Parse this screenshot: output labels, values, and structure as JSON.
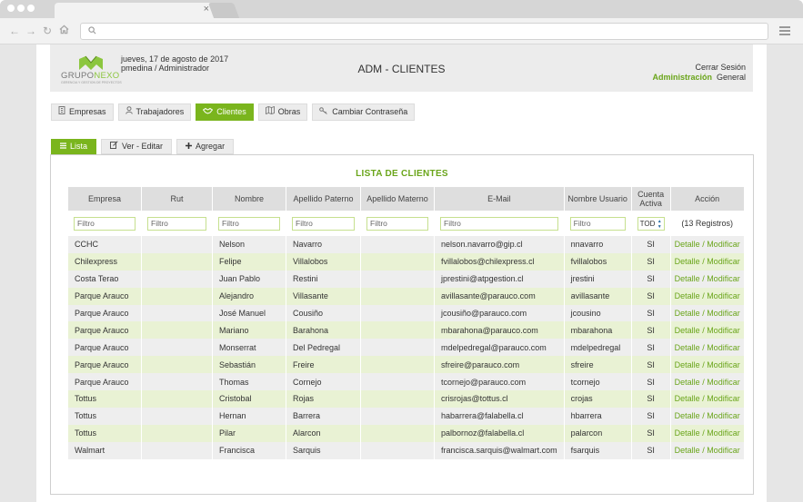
{
  "browser": {
    "tab_close": "×",
    "nav_icons": [
      "back-icon",
      "forward-icon",
      "reload-icon",
      "home-icon"
    ],
    "url_icon": "search-icon"
  },
  "header": {
    "logo_word_1": "GRUPO",
    "logo_word_2": "NEXO",
    "logo_tagline": "GERENCIA Y GESTION DE PROYECTOS",
    "date": "jueves, 17 de agosto de 2017",
    "user": "pmedina / Administrador",
    "title": "ADM - CLIENTES",
    "logout": "Cerrar Sesión",
    "admin_link": "Administración",
    "general_link": "General"
  },
  "mainnav": [
    {
      "label": "Empresas",
      "icon": "building-icon"
    },
    {
      "label": "Trabajadores",
      "icon": "user-icon"
    },
    {
      "label": "Clientes",
      "icon": "handshake-icon"
    },
    {
      "label": "Obras",
      "icon": "map-icon"
    },
    {
      "label": "Cambiar Contraseña",
      "icon": "key-icon"
    }
  ],
  "subnav": [
    {
      "label": "Lista",
      "icon": "list-icon"
    },
    {
      "label": "Ver - Editar",
      "icon": "edit-icon"
    },
    {
      "label": "Agregar",
      "icon": "plus-icon"
    }
  ],
  "list": {
    "title": "LISTA DE CLIENTES",
    "columns": [
      "Empresa",
      "Rut",
      "Nombre",
      "Apellido Paterno",
      "Apellido Materno",
      "E-Mail",
      "Nombre Usuario",
      "Cuenta Activa",
      "Acción"
    ],
    "filter_placeholder": "Filtro",
    "active_filter_value": "TOD",
    "records": "(13 Registros)",
    "action_label": "Detalle / Modificar",
    "rows": [
      {
        "empresa": "CCHC",
        "rut": "",
        "nombre": "Nelson",
        "apellido_p": "Navarro",
        "apellido_m": "",
        "email": "nelson.navarro@gip.cl",
        "usuario": "nnavarro",
        "activa": "SI"
      },
      {
        "empresa": "Chilexpress",
        "rut": "",
        "nombre": "Felipe",
        "apellido_p": "Villalobos",
        "apellido_m": "",
        "email": "fvillalobos@chilexpress.cl",
        "usuario": "fvillalobos",
        "activa": "SI"
      },
      {
        "empresa": "Costa Terao",
        "rut": "",
        "nombre": "Juan Pablo",
        "apellido_p": "Restini",
        "apellido_m": "",
        "email": "jprestini@atpgestion.cl",
        "usuario": "jrestini",
        "activa": "SI"
      },
      {
        "empresa": "Parque Arauco",
        "rut": "",
        "nombre": "Alejandro",
        "apellido_p": "Villasante",
        "apellido_m": "",
        "email": "avillasante@parauco.com",
        "usuario": "avillasante",
        "activa": "SI"
      },
      {
        "empresa": "Parque Arauco",
        "rut": "",
        "nombre": "José Manuel",
        "apellido_p": "Cousiño",
        "apellido_m": "",
        "email": "jcousiño@parauco.com",
        "usuario": "jcousino",
        "activa": "SI"
      },
      {
        "empresa": "Parque Arauco",
        "rut": "",
        "nombre": "Mariano",
        "apellido_p": "Barahona",
        "apellido_m": "",
        "email": "mbarahona@parauco.com",
        "usuario": "mbarahona",
        "activa": "SI"
      },
      {
        "empresa": "Parque Arauco",
        "rut": "",
        "nombre": "Monserrat",
        "apellido_p": "Del Pedregal",
        "apellido_m": "",
        "email": "mdelpedregal@parauco.com",
        "usuario": "mdelpedregal",
        "activa": "SI"
      },
      {
        "empresa": "Parque Arauco",
        "rut": "",
        "nombre": "Sebastián",
        "apellido_p": "Freire",
        "apellido_m": "",
        "email": "sfreire@parauco.com",
        "usuario": "sfreire",
        "activa": "SI"
      },
      {
        "empresa": "Parque Arauco",
        "rut": "",
        "nombre": "Thomas",
        "apellido_p": "Cornejo",
        "apellido_m": "",
        "email": "tcornejo@parauco.com",
        "usuario": "tcornejo",
        "activa": "SI"
      },
      {
        "empresa": "Tottus",
        "rut": "",
        "nombre": "Cristobal",
        "apellido_p": "Rojas",
        "apellido_m": "",
        "email": "crisrojas@tottus.cl",
        "usuario": "crojas",
        "activa": "SI"
      },
      {
        "empresa": "Tottus",
        "rut": "",
        "nombre": "Hernan",
        "apellido_p": "Barrera",
        "apellido_m": "",
        "email": "habarrera@falabella.cl",
        "usuario": "hbarrera",
        "activa": "SI"
      },
      {
        "empresa": "Tottus",
        "rut": "",
        "nombre": "Pilar",
        "apellido_p": "Alarcon",
        "apellido_m": "",
        "email": "palbornoz@falabella.cl",
        "usuario": "palarcon",
        "activa": "SI"
      },
      {
        "empresa": "Walmart",
        "rut": "",
        "nombre": "Francisca",
        "apellido_p": "Sarquis",
        "apellido_m": "",
        "email": "francisca.sarquis@walmart.com",
        "usuario": "fsarquis",
        "activa": "SI"
      }
    ]
  },
  "colors": {
    "accent": "#7ab51d",
    "accent_text": "#6aa51a",
    "row_odd": "#eeeeee",
    "row_even": "#e9f2d4",
    "header_bg": "#ececec"
  }
}
